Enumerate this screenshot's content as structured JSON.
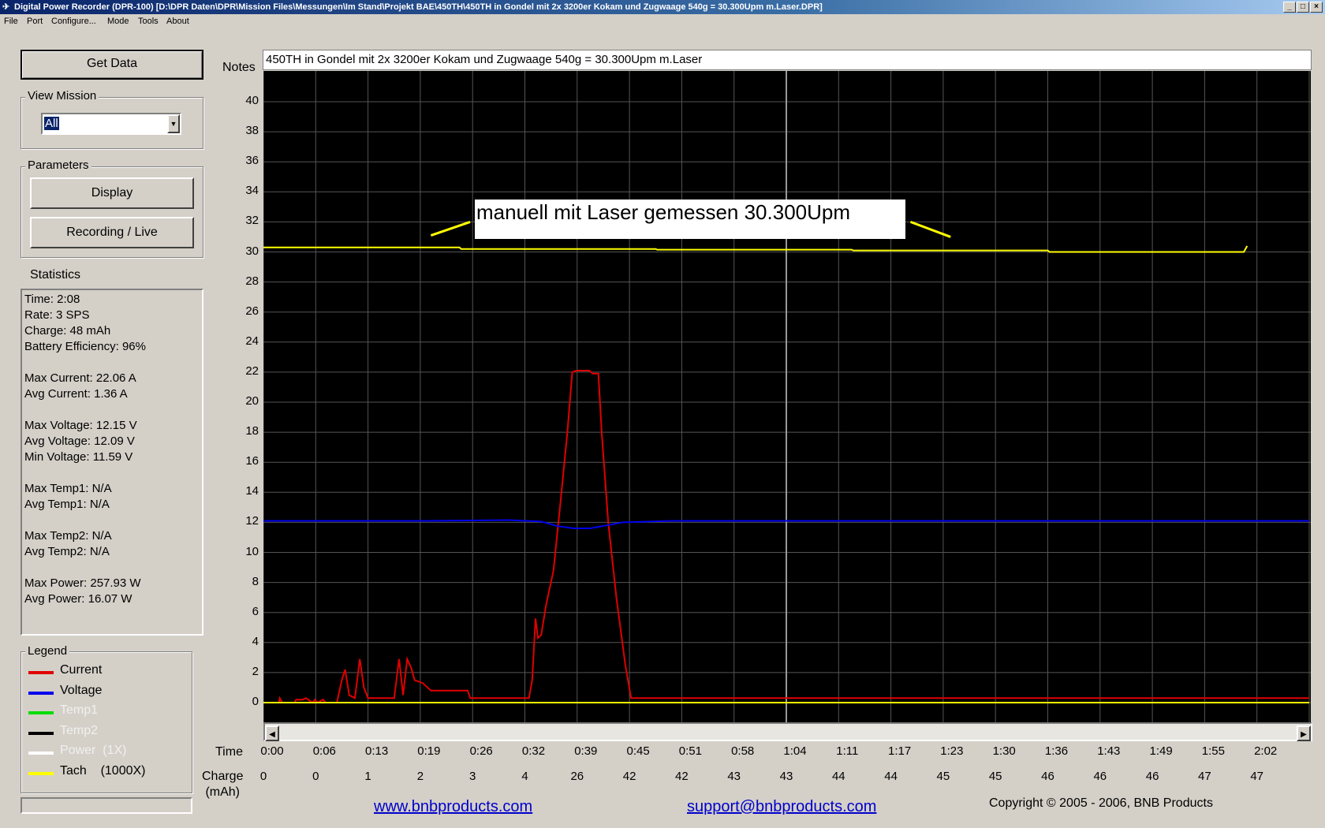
{
  "window": {
    "title": "Digital Power Recorder (DPR-100) [D:\\DPR Daten\\DPR\\Mission Files\\Messungen\\Im Stand\\Projekt BAE\\450TH\\450TH in Gondel mit 2x 3200er Kokam und Zugwaage 540g = 30.300Upm m.Laser.DPR]"
  },
  "menu": [
    "File",
    "Port",
    "Configure...",
    "Mode",
    "Tools",
    "About"
  ],
  "sidebar": {
    "get_data": "Get Data",
    "view_mission_label": "View Mission",
    "view_mission_value": "All",
    "parameters_label": "Parameters",
    "display_button": "Display",
    "recording_button": "Recording / Live",
    "statistics_label": "Statistics",
    "statistics": [
      "Time: 2:08",
      "Rate: 3 SPS",
      "Charge: 48 mAh",
      "Battery Efficiency: 96%",
      "",
      "Max Current: 22.06 A",
      "Avg Current: 1.36 A",
      "",
      "Max Voltage: 12.15 V",
      "Avg Voltage: 12.09 V",
      "Min Voltage: 11.59 V",
      "",
      "Max Temp1: N/A",
      "Avg Temp1: N/A",
      "",
      "Max Temp2: N/A",
      "Avg Temp2: N/A",
      "",
      "Max Power: 257.93 W",
      "Avg Power: 16.07 W"
    ],
    "legend_label": "Legend",
    "legend": [
      {
        "label": "Current",
        "color": "#e00000",
        "active": true
      },
      {
        "label": "Voltage",
        "color": "#0000ee",
        "active": true
      },
      {
        "label": "Temp1",
        "color": "#00dd00",
        "active": false
      },
      {
        "label": "Temp2",
        "color": "#000000",
        "active": false
      },
      {
        "label": "Power  (1X)",
        "color": "#ffffff",
        "active": false
      },
      {
        "label": "Tach    (1000X)",
        "color": "#ffff00",
        "active": true
      }
    ]
  },
  "notes": {
    "label": "Notes",
    "value": "450TH in Gondel mit 2x 3200er Kokam und Zugwaage 540g = 30.300Upm m.Laser"
  },
  "annotation": "manuell mit Laser gemessen 30.300Upm",
  "axis": {
    "time_label": "Time",
    "charge_label": "Charge\n(mAh)"
  },
  "chart_data": {
    "type": "line",
    "ylim": [
      -1,
      42.5
    ],
    "y_ticks": [
      0,
      2,
      4,
      6,
      8,
      10,
      12,
      14,
      16,
      18,
      20,
      22,
      24,
      26,
      28,
      30,
      32,
      34,
      36,
      38,
      40
    ],
    "x_ticks": [
      "0:00",
      "0:06",
      "0:13",
      "0:19",
      "0:26",
      "0:32",
      "0:39",
      "0:45",
      "0:51",
      "0:58",
      "1:04",
      "1:11",
      "1:17",
      "1:23",
      "1:30",
      "1:36",
      "1:43",
      "1:49",
      "1:55",
      "2:02"
    ],
    "charge_ticks": [
      "0",
      "0",
      "1",
      "2",
      "3",
      "4",
      "26",
      "42",
      "42",
      "43",
      "43",
      "44",
      "44",
      "45",
      "45",
      "46",
      "46",
      "46",
      "47",
      "47"
    ],
    "xlim": [
      0,
      128
    ],
    "series": [
      {
        "name": "Current",
        "color": "#e00000",
        "points": [
          [
            0,
            0
          ],
          [
            1.9,
            0
          ],
          [
            2,
            0.3
          ],
          [
            2.3,
            0
          ],
          [
            3.8,
            0
          ],
          [
            4,
            0.2
          ],
          [
            4.8,
            0.2
          ],
          [
            5.2,
            0.3
          ],
          [
            6,
            0
          ],
          [
            6.3,
            0.2
          ],
          [
            6.6,
            0
          ],
          [
            7.3,
            0.2
          ],
          [
            7.6,
            0
          ],
          [
            9,
            0
          ],
          [
            9.6,
            1.5
          ],
          [
            10,
            2.2
          ],
          [
            10.5,
            0.5
          ],
          [
            11.2,
            0.3
          ],
          [
            11.8,
            2.9
          ],
          [
            12.3,
            1
          ],
          [
            12.8,
            0.3
          ],
          [
            16,
            0.3
          ],
          [
            16.6,
            2.9
          ],
          [
            17.1,
            0.5
          ],
          [
            17.6,
            2.9
          ],
          [
            18.1,
            2.3
          ],
          [
            18.5,
            1.5
          ],
          [
            19.5,
            1.3
          ],
          [
            20.5,
            0.8
          ],
          [
            25,
            0.8
          ],
          [
            25.3,
            0.3
          ],
          [
            32.5,
            0.3
          ],
          [
            32.9,
            1.5
          ],
          [
            33.3,
            5.6
          ],
          [
            33.6,
            4.3
          ],
          [
            34,
            4.5
          ],
          [
            34.6,
            6.5
          ],
          [
            35.5,
            8.8
          ],
          [
            36.3,
            13
          ],
          [
            37.2,
            18
          ],
          [
            37.8,
            22
          ],
          [
            38.3,
            22.1
          ],
          [
            39.9,
            22.1
          ],
          [
            40.3,
            21.9
          ],
          [
            41,
            21.9
          ],
          [
            41.4,
            18
          ],
          [
            42.2,
            12
          ],
          [
            43.2,
            7
          ],
          [
            44.3,
            2.5
          ],
          [
            45,
            0.3
          ],
          [
            70,
            0.3
          ],
          [
            128,
            0.3
          ]
        ]
      },
      {
        "name": "Voltage",
        "color": "#0000ee",
        "points": [
          [
            0,
            12.1
          ],
          [
            10,
            12.1
          ],
          [
            20,
            12.1
          ],
          [
            30,
            12.15
          ],
          [
            34,
            12.05
          ],
          [
            36,
            11.75
          ],
          [
            38,
            11.6
          ],
          [
            40,
            11.6
          ],
          [
            42,
            11.8
          ],
          [
            44,
            12.0
          ],
          [
            50,
            12.1
          ],
          [
            80,
            12.1
          ],
          [
            128,
            12.1
          ]
        ]
      },
      {
        "name": "Tach",
        "color": "#ffff00",
        "points": [
          [
            0,
            30.3
          ],
          [
            24,
            30.3
          ],
          [
            24.2,
            30.2
          ],
          [
            48,
            30.2
          ],
          [
            48.2,
            30.15
          ],
          [
            72,
            30.15
          ],
          [
            72.2,
            30.1
          ],
          [
            96,
            30.1
          ],
          [
            96.2,
            30.0
          ],
          [
            120,
            30.0
          ],
          [
            120.4,
            30.4
          ]
        ]
      },
      {
        "name": "Tach0",
        "color": "#ffff00",
        "points": [
          [
            0,
            0
          ],
          [
            128,
            0
          ]
        ]
      }
    ],
    "annotation_leaders": [
      {
        "from": [
          20.5,
          31.1
        ],
        "to": [
          25.3,
          32.0
        ]
      },
      {
        "from": [
          79.2,
          32.0
        ],
        "to": [
          84.1,
          31.0
        ]
      }
    ]
  },
  "footer": {
    "link1": "www.bnbproducts.com",
    "link2": "support@bnbproducts.com",
    "copyright": "Copyright © 2005 - 2006, BNB Products"
  }
}
